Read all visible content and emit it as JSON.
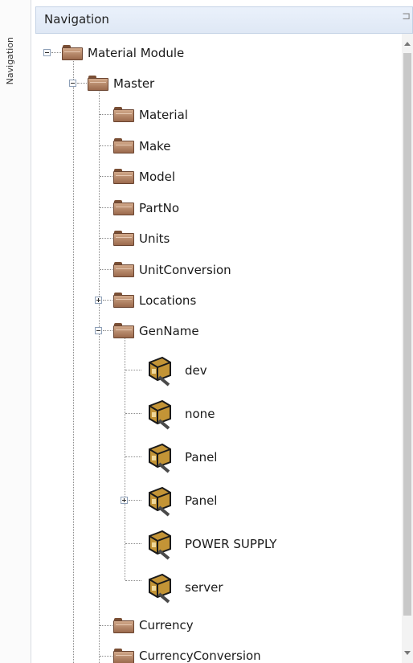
{
  "strip": {
    "text": "Navigation"
  },
  "panel": {
    "title": "Navigation",
    "pin_icon": "pin-icon"
  },
  "tree": {
    "root": "Material Module",
    "master": "Master",
    "master_items": [
      "Material",
      "Make",
      "Model",
      "PartNo",
      "Units",
      "UnitConversion",
      "Locations",
      "GenName"
    ],
    "genname_items": [
      "dev",
      "none",
      "Panel",
      "Panel",
      "POWER SUPPLY",
      "server"
    ],
    "after_items": [
      "Currency",
      "CurrencyConversion"
    ]
  },
  "colors": {
    "header_bg": "#dfe8f5",
    "folder": "#9b6a4d",
    "gen_icon": "#b5872a"
  }
}
